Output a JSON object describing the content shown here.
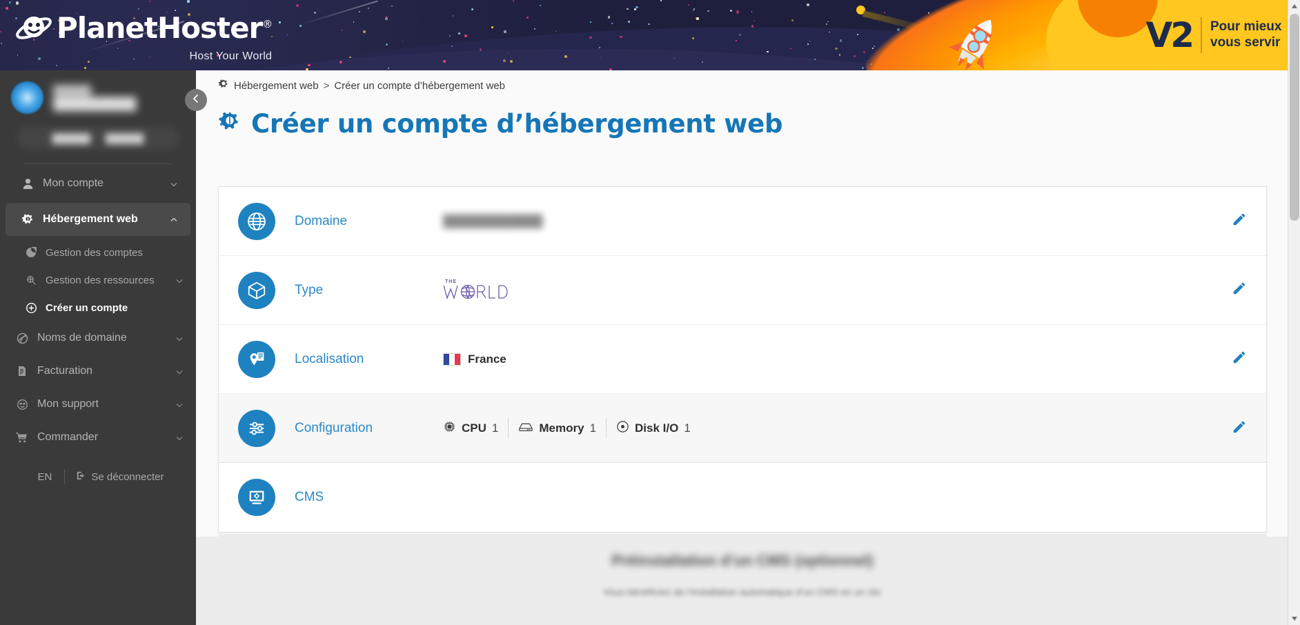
{
  "banner": {
    "brand": "PlanetHoster",
    "brand_registered": "®",
    "tagline": "Host Your World",
    "v2_mark": "V2",
    "v2_line1": "Pour mieux",
    "v2_line2": "vous servir",
    "colors": {
      "sky": "#1e1f3c",
      "yellow": "#ffc71f",
      "orange": "#f57c00",
      "navy": "#1e2a4a"
    }
  },
  "sidebar": {
    "user": {
      "name_small": "██████",
      "name_large": "██████████"
    },
    "credit_pill": {
      "left": "██████",
      "right": "██████"
    },
    "items": [
      {
        "label": "Mon compte",
        "icon": "user-icon",
        "expandable": true,
        "expanded": false,
        "active": false
      },
      {
        "label": "Hébergement web",
        "icon": "gear-icon",
        "expandable": true,
        "expanded": true,
        "active": true
      },
      {
        "label": "Noms de domaine",
        "icon": "domain-icon",
        "expandable": true,
        "expanded": false,
        "active": false
      },
      {
        "label": "Facturation",
        "icon": "invoice-icon",
        "expandable": true,
        "expanded": false,
        "active": false
      },
      {
        "label": "Mon support",
        "icon": "support-icon",
        "expandable": true,
        "expanded": false,
        "active": false
      },
      {
        "label": "Commander",
        "icon": "cart-icon",
        "expandable": true,
        "expanded": false,
        "active": false
      }
    ],
    "sub_items": [
      {
        "label": "Gestion des comptes",
        "icon": "accounts-icon",
        "expandable": false,
        "selected": false
      },
      {
        "label": "Gestion des ressources",
        "icon": "resources-icon",
        "expandable": true,
        "selected": false
      },
      {
        "label": "Créer un compte",
        "icon": "plus-circle-icon",
        "expandable": false,
        "selected": true
      }
    ],
    "footer": {
      "lang": "EN",
      "logout": "Se déconnecter"
    },
    "collapse_icon": "chevron-left-icon"
  },
  "breadcrumb": {
    "icon": "gear-icon",
    "parent": "Hébergement web",
    "separator": ">",
    "current": "Créer un compte d’hébergement web"
  },
  "page": {
    "title": "Créer un compte d’hébergement web",
    "title_icon": "gear-icon",
    "title_color": "#1676b6"
  },
  "rows": [
    {
      "key": "domaine",
      "label": "Domaine",
      "icon": "globe-icon",
      "value_type": "blurred",
      "value": "████████████",
      "edit_icon": "pencil-icon",
      "shaded": false
    },
    {
      "key": "type",
      "label": "Type",
      "icon": "cube-icon",
      "value_type": "logo",
      "value": "WORLD",
      "value_sup": "THE",
      "edit_icon": "pencil-icon",
      "shaded": false
    },
    {
      "key": "localisation",
      "label": "Localisation",
      "icon": "location-server-icon",
      "value_type": "country",
      "value": "France",
      "flag": "fr",
      "edit_icon": "pencil-icon",
      "shaded": false
    },
    {
      "key": "configuration",
      "label": "Configuration",
      "icon": "sliders-icon",
      "value_type": "config",
      "edit_icon": "pencil-icon",
      "shaded": true,
      "config": [
        {
          "icon": "cpu-icon",
          "name": "CPU",
          "value": "1"
        },
        {
          "icon": "memory-icon",
          "name": "Memory",
          "value": "1"
        },
        {
          "icon": "disk-icon",
          "name": "Disk I/O",
          "value": "1"
        }
      ]
    }
  ],
  "cms_row": {
    "key": "cms",
    "label": "CMS",
    "icon": "cms-monitor-icon"
  },
  "cms_section": {
    "heading": "Préinstallation d’un CMS (optionnel)",
    "subtext": "Vous bénéficiez de l’installation automatique d’un CMS en un clic"
  },
  "scrollbar": {
    "up_icon": "arrow-up-icon",
    "down_icon": "arrow-down-icon"
  }
}
